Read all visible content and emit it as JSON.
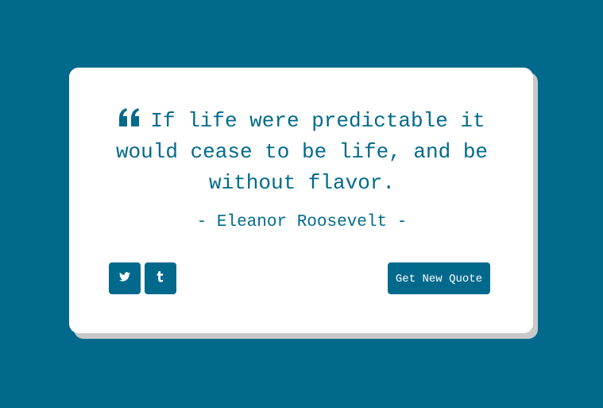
{
  "colors": {
    "background": "#016a8c",
    "card": "#ffffff",
    "card_shadow": "#c9c9c9",
    "accent": "#016a8c",
    "button_text": "#ffffff"
  },
  "quote": {
    "icon": "quote-left-icon",
    "text": "If life were predictable it would cease to be life, and be without flavor.",
    "author": "- Eleanor Roosevelt -"
  },
  "share": {
    "twitter_icon": "twitter-icon",
    "tumblr_icon": "tumblr-icon"
  },
  "actions": {
    "new_quote_label": "Get New Quote"
  }
}
